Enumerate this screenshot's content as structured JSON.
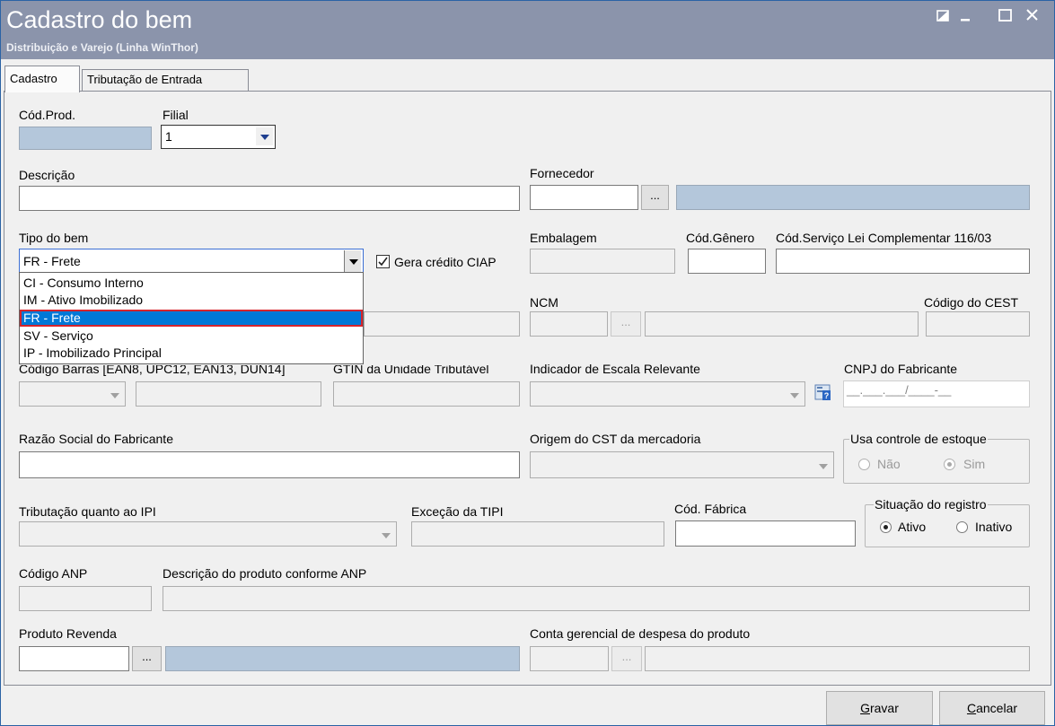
{
  "window": {
    "title": "Cadastro do bem",
    "subtitle": "Distribuição e Varejo (Linha WinThor)"
  },
  "tabs": [
    {
      "label": "Cadastro",
      "active": true
    },
    {
      "label": "Tributação de Entrada",
      "active": false
    }
  ],
  "fields": {
    "cod_prod": {
      "label": "Cód.Prod.",
      "value": ""
    },
    "filial": {
      "label": "Filial",
      "value": "1"
    },
    "descricao": {
      "label": "Descrição",
      "value": ""
    },
    "fornecedor": {
      "label": "Fornecedor",
      "value": "",
      "button": "..."
    },
    "tipo_bem": {
      "label": "Tipo do bem",
      "value": "FR - Frete"
    },
    "gera_credito": {
      "label": "Gera crédito CIAP",
      "checked": true
    },
    "embalagem": {
      "label": "Embalagem",
      "value": ""
    },
    "cod_genero": {
      "label": "Cód.Gênero",
      "value": ""
    },
    "cod_servico": {
      "label": "Cód.Serviço Lei Complementar 116/03",
      "value": ""
    },
    "ncm": {
      "label": "NCM",
      "value": "",
      "button": "..."
    },
    "codigo_cest": {
      "label": "Código do CEST",
      "value": ""
    },
    "codigo_barras": {
      "label": "Código Barras [EAN8, UPC12, EAN13, DUN14]",
      "value": ""
    },
    "gtin": {
      "label": "GTIN da Unidade Tributável",
      "value": ""
    },
    "indicador_escala": {
      "label": "Indicador de Escala Relevante",
      "value": ""
    },
    "cnpj_fabricante": {
      "label": "CNPJ do Fabricante",
      "mask": "__.___.___/____-__"
    },
    "razao_social": {
      "label": "Razão Social do Fabricante",
      "value": ""
    },
    "origem_cst": {
      "label": "Origem do CST da mercadoria",
      "value": ""
    },
    "trib_ipi": {
      "label": "Tributação quanto ao IPI",
      "value": ""
    },
    "excecao_tipi": {
      "label": "Exceção da TIPI",
      "value": ""
    },
    "cod_fabrica": {
      "label": "Cód. Fábrica",
      "value": ""
    },
    "codigo_anp": {
      "label": "Código ANP",
      "value": ""
    },
    "desc_anp": {
      "label": "Descrição do produto conforme ANP",
      "value": ""
    },
    "produto_revenda": {
      "label": "Produto Revenda",
      "value": "",
      "button": "..."
    },
    "conta_gerencial": {
      "label": "Conta gerencial de despesa do produto",
      "value": "",
      "button": "..."
    }
  },
  "tipo_bem_options": [
    {
      "label": "CI - Consumo Interno",
      "selected": false
    },
    {
      "label": "IM - Ativo Imobilizado",
      "selected": false
    },
    {
      "label": "FR - Frete",
      "selected": true
    },
    {
      "label": "SV - Serviço",
      "selected": false
    },
    {
      "label": "IP - Imobilizado Principal",
      "selected": false
    }
  ],
  "usa_controle_estoque": {
    "title": "Usa controle de estoque",
    "options": [
      "Não",
      "Sim"
    ],
    "selected": "Sim",
    "enabled": false
  },
  "situacao_registro": {
    "title": "Situação do registro",
    "options": [
      "Ativo",
      "Inativo"
    ],
    "selected": "Ativo"
  },
  "buttons": {
    "save_prefix": "G",
    "save_rest": "ravar",
    "cancel_prefix": "C",
    "cancel_rest": "ancelar"
  }
}
